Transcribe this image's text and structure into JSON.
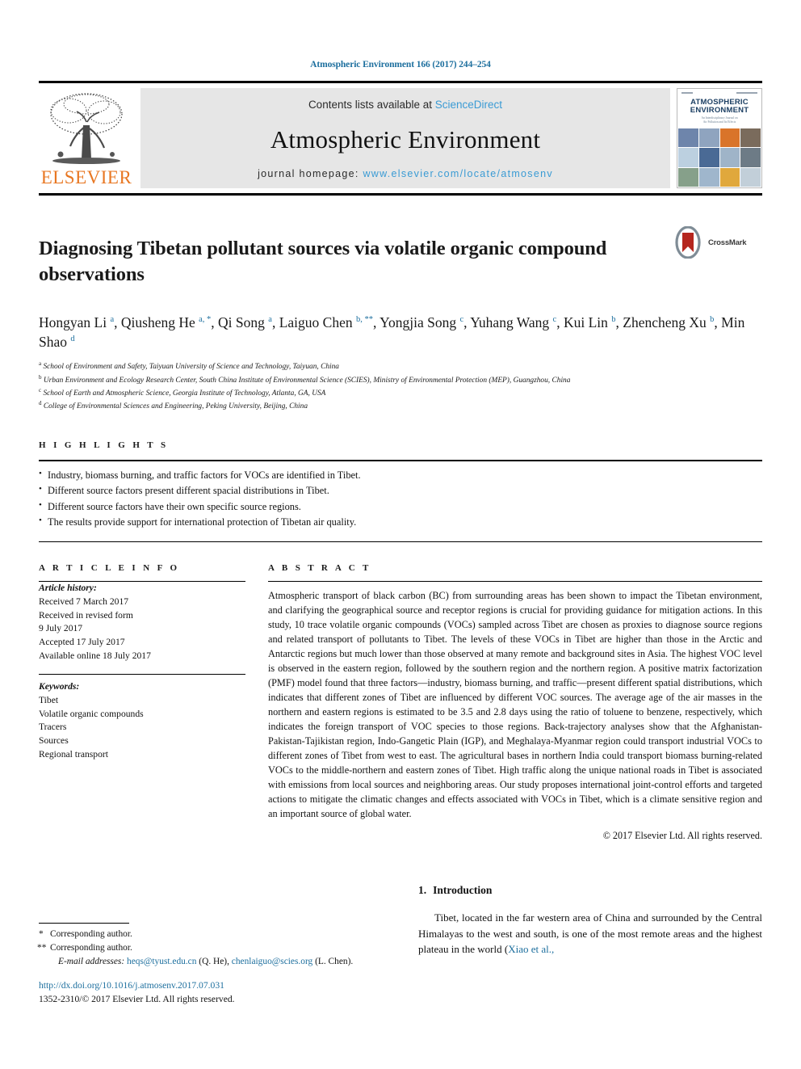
{
  "running_head": "Atmospheric Environment 166 (2017) 244–254",
  "masthead": {
    "publisher_name": "ELSEVIER",
    "contents_prefix": "Contents lists available at ",
    "contents_link": "ScienceDirect",
    "journal_title": "Atmospheric Environment",
    "homepage_prefix": "journal homepage: ",
    "homepage_url": "www.elsevier.com/locate/atmosenv",
    "cover": {
      "title_line1": "ATMOSPHERIC",
      "title_line2": "ENVIRONMENT",
      "subtitle_line1": "An Interdisciplinary Journal on",
      "subtitle_line2": "Air Pollution and Its Effects"
    }
  },
  "article": {
    "title": "Diagnosing Tibetan pollutant sources via volatile organic compound observations",
    "crossmark_label": "CrossMark",
    "authors": [
      {
        "name": "Hongyan Li",
        "marks": "a"
      },
      {
        "name": "Qiusheng He",
        "marks": "a, *"
      },
      {
        "name": "Qi Song",
        "marks": "a"
      },
      {
        "name": "Laiguo Chen",
        "marks": "b, **"
      },
      {
        "name": "Yongjia Song",
        "marks": "c"
      },
      {
        "name": "Yuhang Wang",
        "marks": "c"
      },
      {
        "name": "Kui Lin",
        "marks": "b"
      },
      {
        "name": "Zhencheng Xu",
        "marks": "b"
      },
      {
        "name": "Min Shao",
        "marks": "d"
      }
    ],
    "affiliations": [
      {
        "mark": "a",
        "text": "School of Environment and Safety, Taiyuan University of Science and Technology, Taiyuan, China"
      },
      {
        "mark": "b",
        "text": "Urban Environment and Ecology Research Center, South China Institute of Environmental Science (SCIES), Ministry of Environmental Protection (MEP), Guangzhou, China"
      },
      {
        "mark": "c",
        "text": "School of Earth and Atmospheric Science, Georgia Institute of Technology, Atlanta, GA, USA"
      },
      {
        "mark": "d",
        "text": "College of Environmental Sciences and Engineering, Peking University, Beijing, China"
      }
    ]
  },
  "highlights": {
    "heading": "H I G H L I G H T S",
    "items": [
      "Industry, biomass burning, and traffic factors for VOCs are identified in Tibet.",
      "Different source factors present different spacial distributions in Tibet.",
      "Different source factors have their own specific source regions.",
      "The results provide support for international protection of Tibetan air quality."
    ]
  },
  "article_info": {
    "heading": "A R T I C L E   I N F O",
    "history_label": "Article history:",
    "history": [
      "Received 7 March 2017",
      "Received in revised form",
      "9 July 2017",
      "Accepted 17 July 2017",
      "Available online 18 July 2017"
    ],
    "keywords_label": "Keywords:",
    "keywords": [
      "Tibet",
      "Volatile organic compounds",
      "Tracers",
      "Sources",
      "Regional transport"
    ]
  },
  "abstract": {
    "heading": "A B S T R A C T",
    "text": "Atmospheric transport of black carbon (BC) from surrounding areas has been shown to impact the Tibetan environment, and clarifying the geographical source and receptor regions is crucial for providing guidance for mitigation actions. In this study, 10 trace volatile organic compounds (VOCs) sampled across Tibet are chosen as proxies to diagnose source regions and related transport of pollutants to Tibet. The levels of these VOCs in Tibet are higher than those in the Arctic and Antarctic regions but much lower than those observed at many remote and background sites in Asia. The highest VOC level is observed in the eastern region, followed by the southern region and the northern region. A positive matrix factorization (PMF) model found that three factors—industry, biomass burning, and traffic—present different spatial distributions, which indicates that different zones of Tibet are influenced by different VOC sources. The average age of the air masses in the northern and eastern regions is estimated to be 3.5 and 2.8 days using the ratio of toluene to benzene, respectively, which indicates the foreign transport of VOC species to those regions. Back-trajectory analyses show that the Afghanistan-Pakistan-Tajikistan region, Indo-Gangetic Plain (IGP), and Meghalaya-Myanmar region could transport industrial VOCs to different zones of Tibet from west to east. The agricultural bases in northern India could transport biomass burning-related VOCs to the middle-northern and eastern zones of Tibet. High traffic along the unique national roads in Tibet is associated with emissions from local sources and neighboring areas. Our study proposes international joint-control efforts and targeted actions to mitigate the climatic changes and effects associated with VOCs in Tibet, which is a climate sensitive region and an important source of global water.",
    "copyright": "© 2017 Elsevier Ltd. All rights reserved."
  },
  "introduction": {
    "number": "1.",
    "heading": "Introduction",
    "paragraph_before_cite": "Tibet, located in the far western area of China and surrounded by the Central Himalayas to the west and south, is one of the most remote areas and the highest plateau in the world (",
    "citation": "Xiao et al.,"
  },
  "footnotes": {
    "corresponding_1_mark": "*",
    "corresponding_1": "Corresponding author.",
    "corresponding_2_mark": "**",
    "corresponding_2": "Corresponding author.",
    "email_label": "E-mail addresses:",
    "email_1": "heqs@tyust.edu.cn",
    "email_1_person": "(Q. He),",
    "email_2": "chenlaiguo@scies.org",
    "email_2_person": "(L. Chen)."
  },
  "imprint": {
    "doi": "http://dx.doi.org/10.1016/j.atmosenv.2017.07.031",
    "issn_line": "1352-2310/© 2017 Elsevier Ltd. All rights reserved."
  },
  "colors": {
    "link_blue": "#1d6f9e",
    "science_direct_blue": "#3a9bd4",
    "elsevier_orange": "#e87722",
    "masthead_grey": "#e6e6e6",
    "crossmark_red": "#b5261e"
  }
}
